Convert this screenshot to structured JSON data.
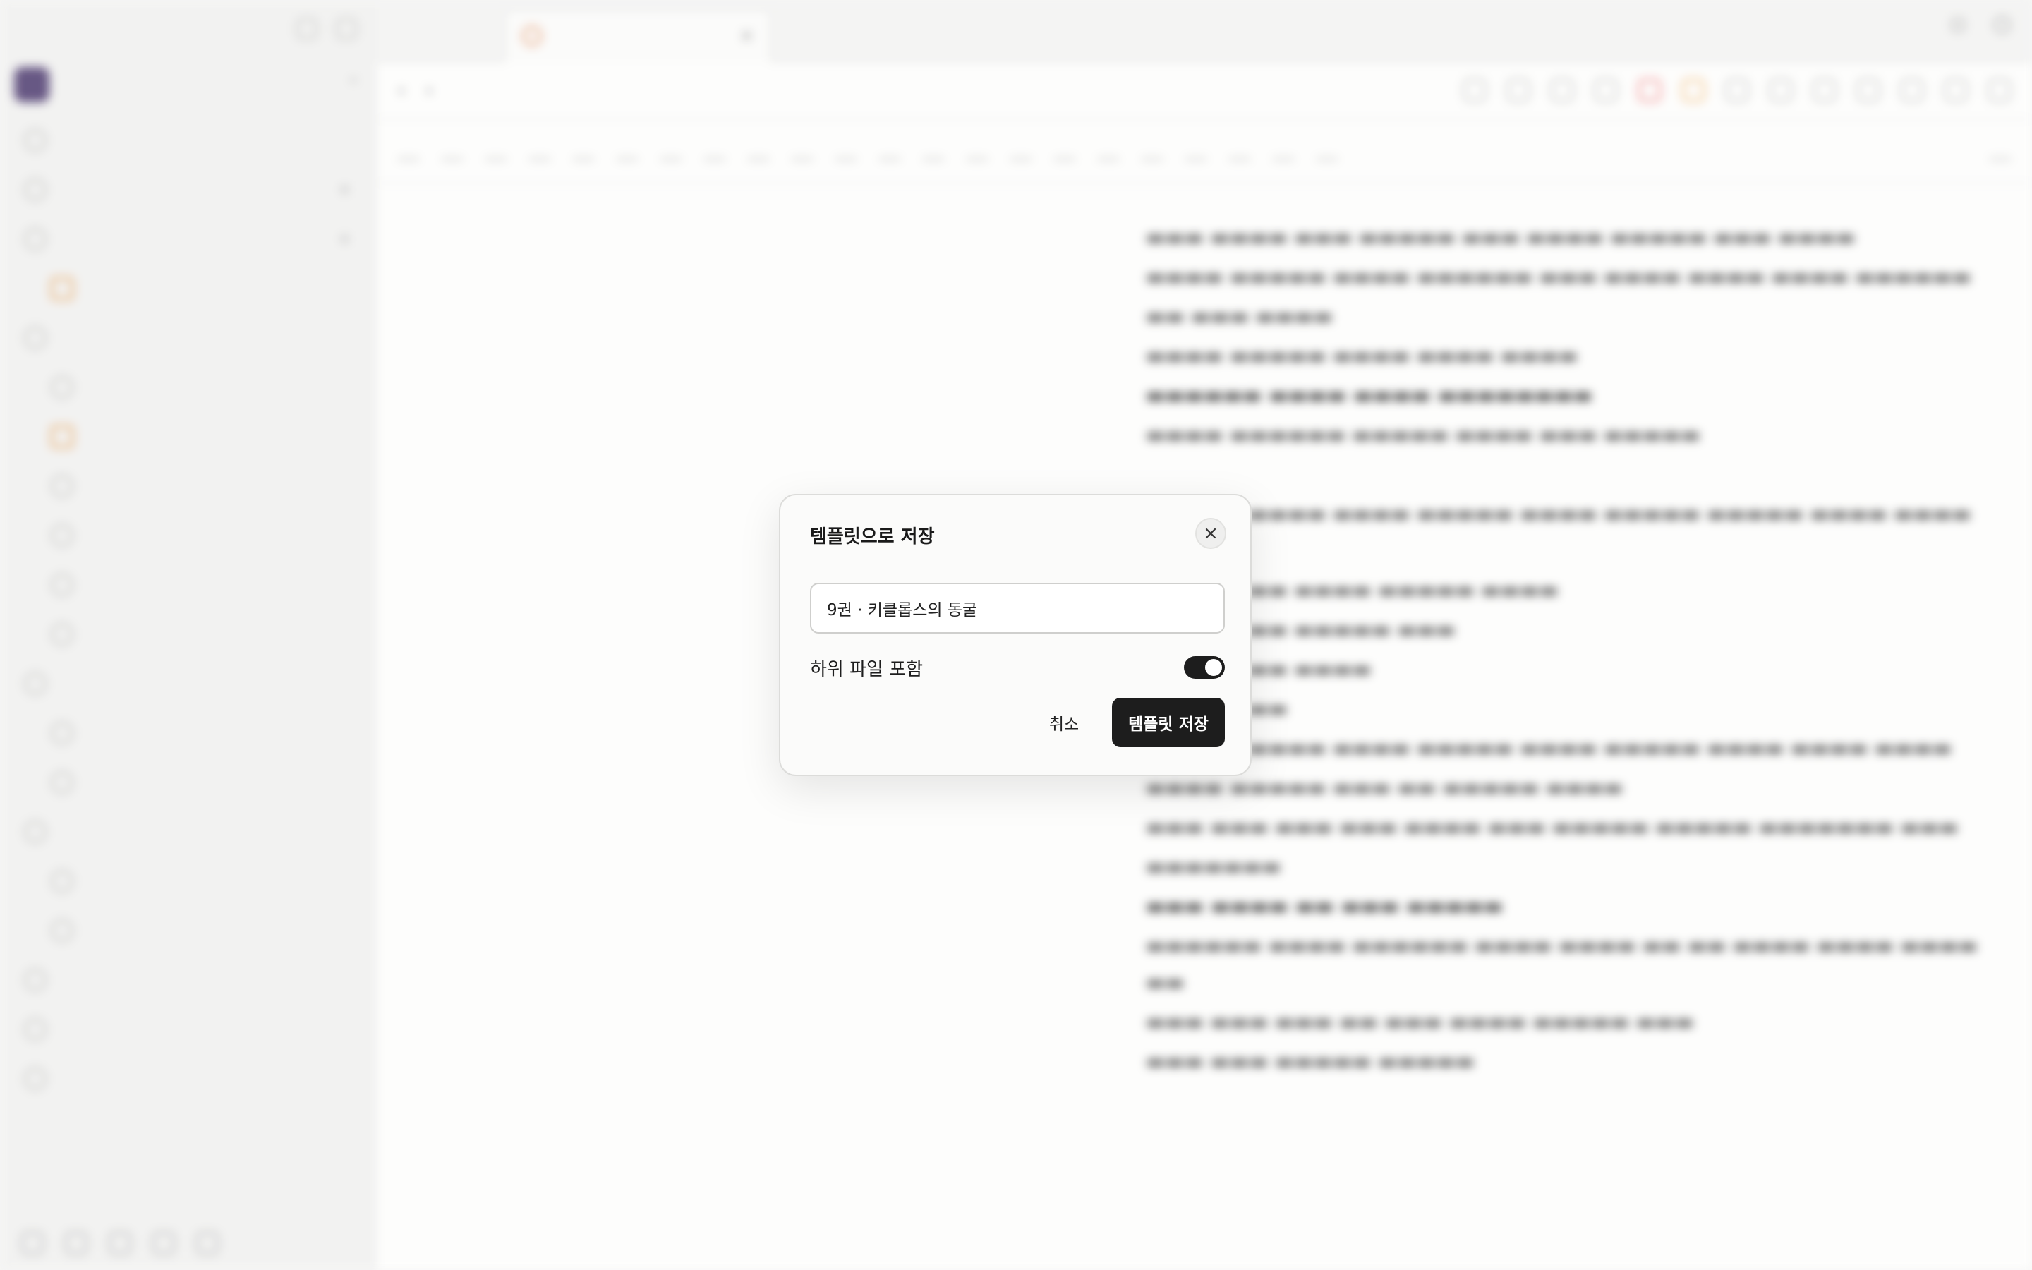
{
  "dialog": {
    "title": "템플릿으로 저장",
    "name_value": "9권 · 키클롭스의 동굴",
    "include_children_label": "하위 파일 포함",
    "include_children_on": true,
    "cancel_label": "취소",
    "save_label": "템플릿 저장"
  },
  "colors": {
    "primary_button": "#1d1d1d",
    "dialog_bg": "#fbfbfa"
  }
}
